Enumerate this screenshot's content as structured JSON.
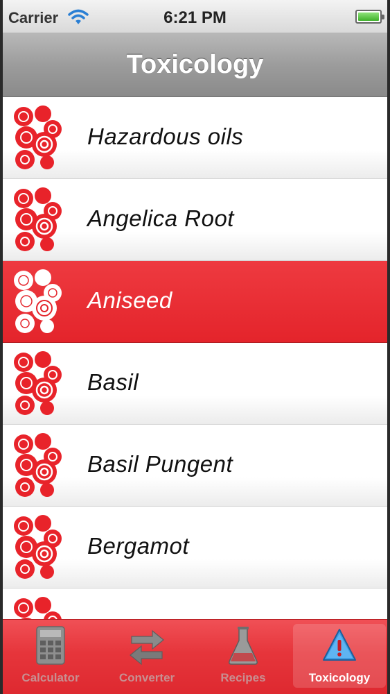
{
  "status_bar": {
    "carrier": "Carrier",
    "time": "6:21 PM"
  },
  "nav": {
    "title": "Toxicology"
  },
  "list": {
    "items": [
      {
        "label": "Hazardous oils",
        "selected": false
      },
      {
        "label": "Angelica Root",
        "selected": false
      },
      {
        "label": "Aniseed",
        "selected": true
      },
      {
        "label": "Basil",
        "selected": false
      },
      {
        "label": "Basil Pungent",
        "selected": false
      },
      {
        "label": "Bergamot",
        "selected": false
      },
      {
        "label": "",
        "selected": false
      }
    ]
  },
  "tab_bar": {
    "tabs": [
      {
        "label": "Calculator",
        "icon": "calculator-icon",
        "active": false
      },
      {
        "label": "Converter",
        "icon": "converter-arrows-icon",
        "active": false
      },
      {
        "label": "Recipes",
        "icon": "flask-icon",
        "active": false
      },
      {
        "label": "Toxicology",
        "icon": "warning-triangle-icon",
        "active": true
      }
    ]
  },
  "colors": {
    "accent_red": "#e4242b",
    "nav_gray": "#9c9c9c"
  }
}
